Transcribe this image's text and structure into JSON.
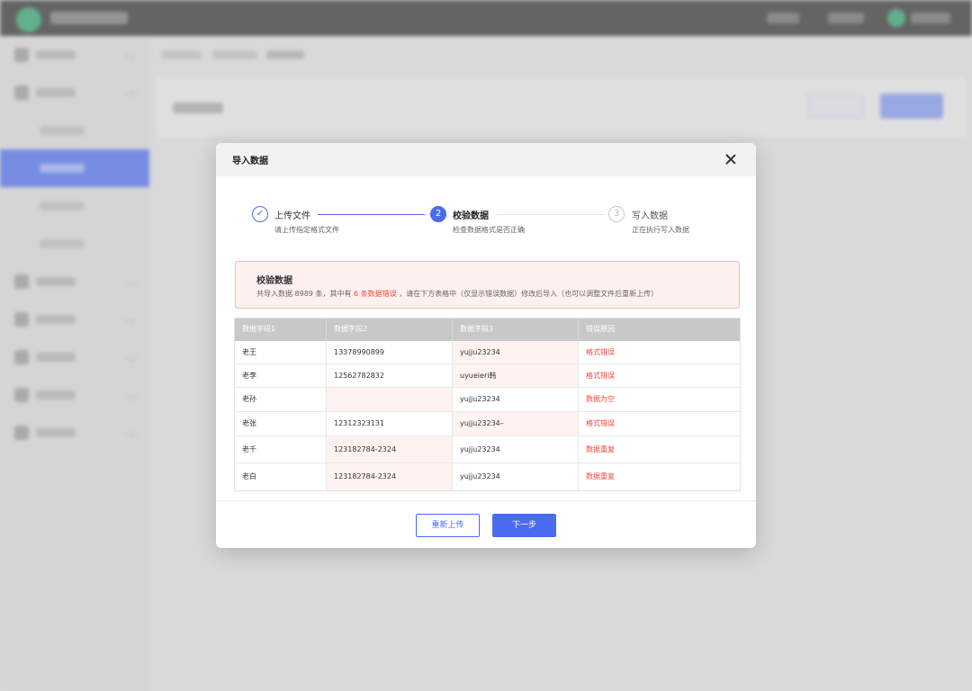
{
  "modal": {
    "title": "导入数据",
    "steps": [
      {
        "index": "✓",
        "title": "上传文件",
        "desc": "请上传指定格式文件",
        "state": "done"
      },
      {
        "index": "2",
        "title": "校验数据",
        "desc": "检查数据格式是否正确",
        "state": "current"
      },
      {
        "index": "3",
        "title": "写入数据",
        "desc": "正在执行写入数据",
        "state": "pending"
      }
    ],
    "alert": {
      "title": "校验数据",
      "text_before": "共导入数据 8989 条，其中有",
      "highlight": "6 条数据错误",
      "text_after": "，请在下方表格中（仅显示错误数据）修改后导入（也可以调整文件后重新上传）"
    },
    "table": {
      "columns": [
        "数据字段1",
        "数据字段2",
        "数据字段3",
        "错误原因"
      ],
      "rows": [
        [
          "老王",
          "13378990899",
          "yujju23234",
          "格式错误"
        ],
        [
          "老李",
          "12562782832",
          "uyueieri韩",
          "格式错误"
        ],
        [
          "老孙",
          "",
          "yujju23234",
          "数据为空"
        ],
        [
          "老张",
          "12312323131",
          "yujju23234–",
          "格式错误"
        ],
        [
          "老千",
          "123182784-2324",
          "yujju23234",
          "数据重复"
        ],
        [
          "老白",
          "123182784-2324",
          "yujju23234",
          "数据重复"
        ]
      ]
    },
    "buttons": {
      "reupload": "重新上传",
      "next": "下一步"
    }
  },
  "colors": {
    "primary": "#4a6cf0",
    "error": "#f04a3e",
    "error_bg": "#fff3f2"
  }
}
